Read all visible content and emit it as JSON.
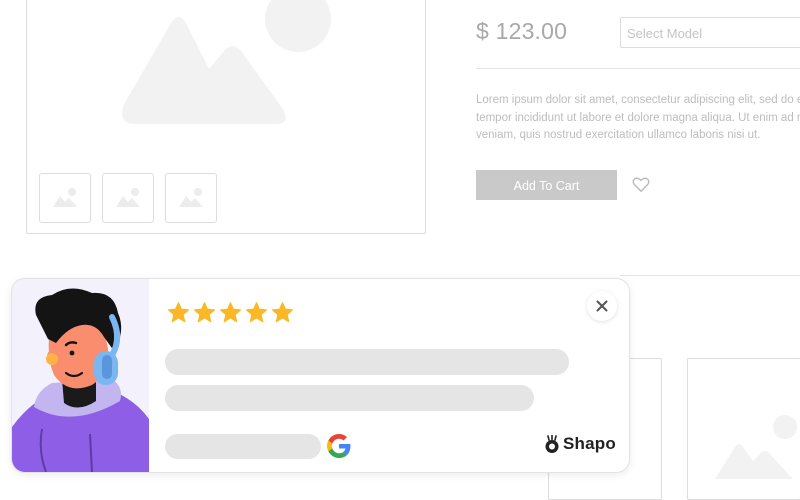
{
  "product": {
    "price": "$ 123.00",
    "model_placeholder": "Select Model",
    "description_lines": [
      "Lorem ipsum dolor sit amet, consectetur adipiscing elit, sed do eius",
      "tempor incididunt ut labore et dolore magna aliqua. Ut enim ad min",
      "veniam, quis nostrud exercitation ullamco laboris nisi ut."
    ],
    "add_to_cart_label": "Add To Cart",
    "wishlist_icon": "heart-icon",
    "image_placeholder_icon": "image-placeholder-icon",
    "thumbnail_count": 3,
    "related_card_count": 2
  },
  "review_popup": {
    "rating": 5,
    "star_color": "#FBB724",
    "source_icon": "google-icon",
    "brand_name": "Shapo",
    "close_icon": "close-icon",
    "avatar": "avatar-with-headphones"
  }
}
